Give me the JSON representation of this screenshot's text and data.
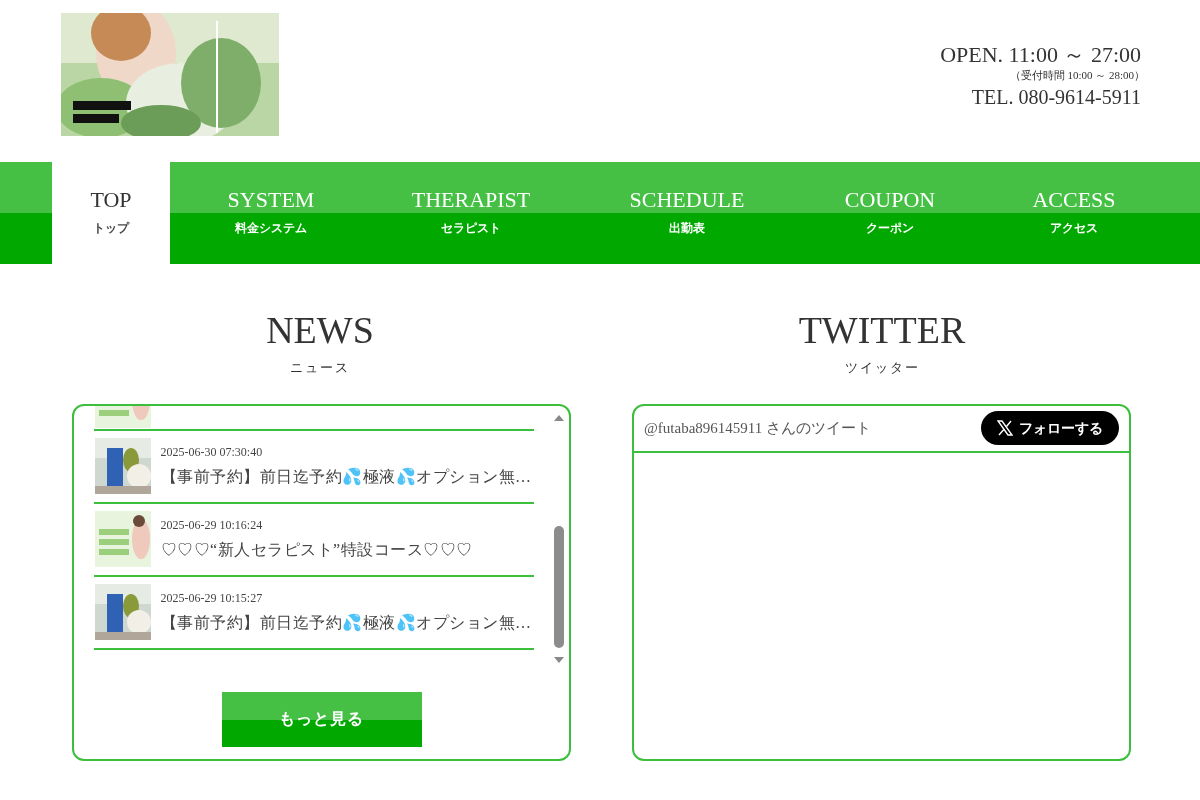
{
  "header": {
    "hours": "OPEN. 11:00 ～ 27:00",
    "reception": "（受付時間 10:00 ～ 28:00）",
    "phone": "TEL. 080-9614-5911"
  },
  "nav": [
    {
      "label": "TOP",
      "sub": "トップ",
      "selected": true
    },
    {
      "label": "SYSTEM",
      "sub": "料金システム",
      "selected": false
    },
    {
      "label": "THERAPIST",
      "sub": "セラピスト",
      "selected": false
    },
    {
      "label": "SCHEDULE",
      "sub": "出勤表",
      "selected": false
    },
    {
      "label": "COUPON",
      "sub": "クーポン",
      "selected": false
    },
    {
      "label": "ACCESS",
      "sub": "アクセス",
      "selected": false
    }
  ],
  "news": {
    "title": "NEWS",
    "subtitle": "ニュース",
    "items": [
      {
        "date": "2025-06-30 07:30:40",
        "title": "【事前予約】前日迄予約💦極液💦オプション無…"
      },
      {
        "date": "2025-06-29 10:16:24",
        "title": "♡♡♡“新人セラピスト”特設コース♡♡♡"
      },
      {
        "date": "2025-06-29 10:15:27",
        "title": "【事前予約】前日迄予約💦極液💦オプション無…"
      }
    ],
    "more_button": "もっと見る"
  },
  "twitter": {
    "title": "TWITTER",
    "subtitle": "ツイッター",
    "account": "@futaba896145911 さんのツイート",
    "follow_button": "フォローする"
  }
}
